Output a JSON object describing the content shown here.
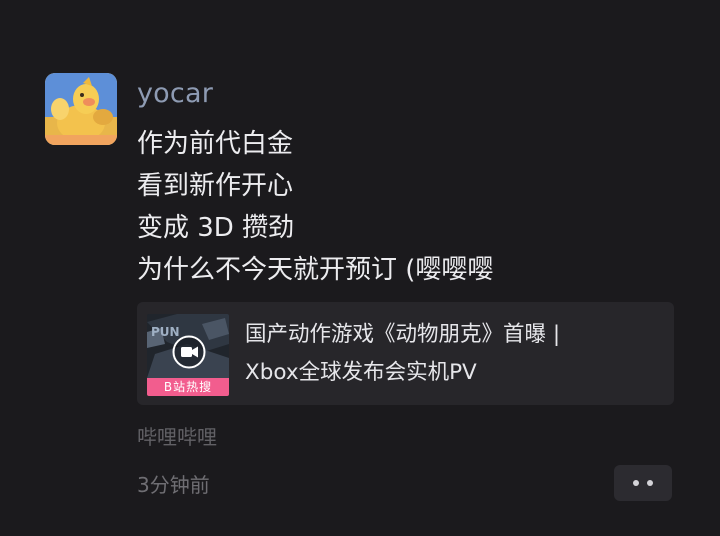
{
  "post": {
    "username": "yocar",
    "message_lines": [
      "作为前代白金",
      "看到新作开心",
      "变成 3D 攒劲",
      "为什么不今天就开预订 (嘤嘤嘤"
    ],
    "link_card": {
      "title_lines": [
        "国产动作游戏《动物朋克》首曝 |",
        "Xbox全球发布会实机PV"
      ],
      "badge": "B站热搜",
      "thumb_icon": "video-play-icon"
    },
    "source": "哔哩哔哩",
    "time": "3分钟前",
    "more_icon": "more-dots-icon"
  },
  "colors": {
    "background": "#1b1a1d",
    "username": "#8e9bb3",
    "card": "#27262a",
    "badge": "#f25d8e",
    "muted": "#626166"
  }
}
